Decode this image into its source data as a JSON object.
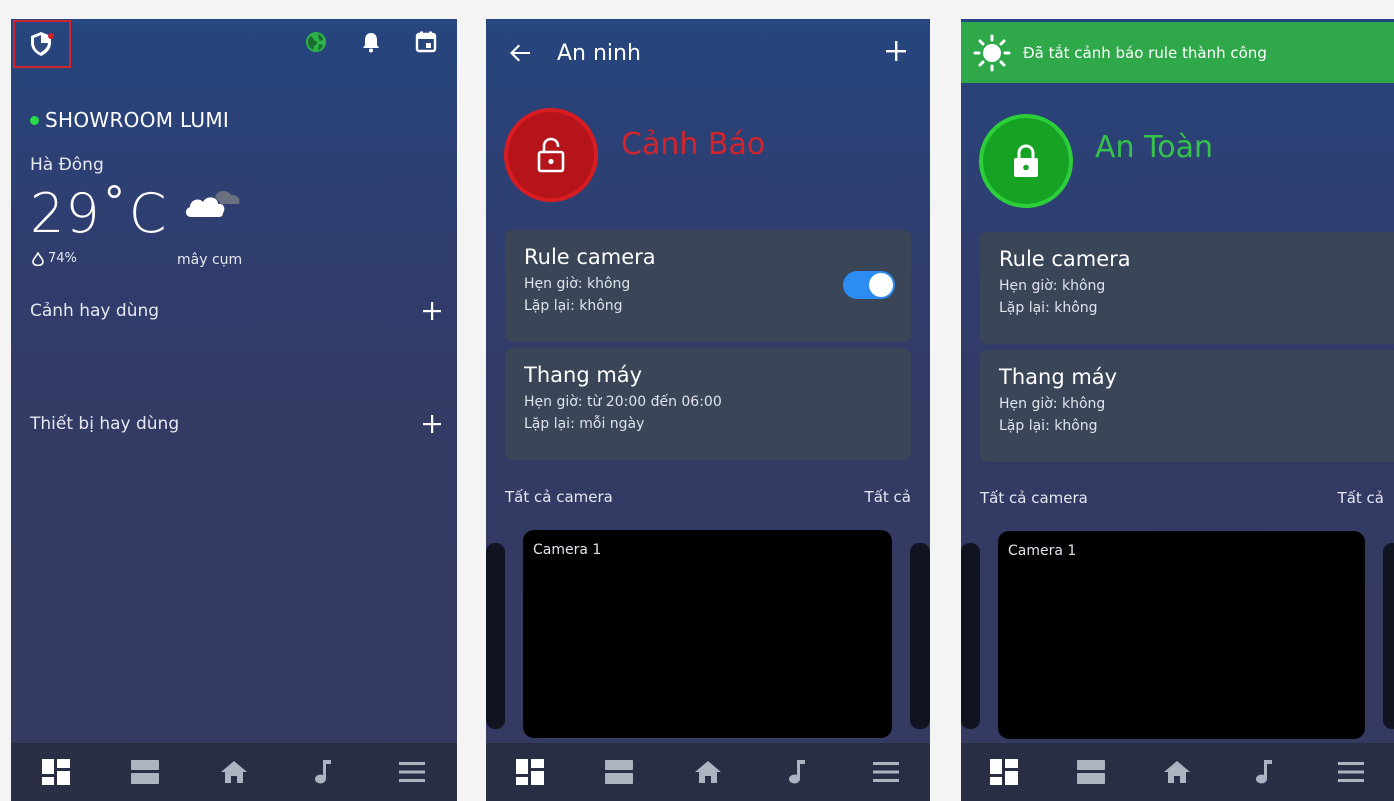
{
  "colors": {
    "alert_red": "#d2242a",
    "safe_green": "#34c24a",
    "toggle_blue": "#2d8cf0",
    "toast_green": "#2fa84a"
  },
  "home": {
    "top_icons": [
      "shield-icon",
      "globe-icon",
      "bell-icon",
      "calendar-icon"
    ],
    "name": "SHOWROOM LUMI",
    "city": "Hà Đông",
    "temperature": "29˚C",
    "humidity": "74%",
    "weather": "mây cụm",
    "favorite_scenes": "Cảnh hay dùng",
    "favorite_devices": "Thiết bị hay dùng"
  },
  "security_alert": {
    "title": "An ninh",
    "status": "Cảnh Báo",
    "rules": [
      {
        "name": "Rule camera",
        "schedule": "Hẹn giờ: không",
        "repeat": "Lặp lại: không",
        "enabled": true
      },
      {
        "name": "Thang máy",
        "schedule": "Hẹn giờ: từ 20:00 đến 06:00",
        "repeat": "Lặp lại: mỗi ngày"
      }
    ],
    "cameras_label": "Tất cả camera",
    "see_all": "Tất cả",
    "camera_name": "Camera 1"
  },
  "security_safe": {
    "toast": "Đã tắt cảnh báo rule thành công",
    "status": "An Toàn",
    "rules": [
      {
        "name": "Rule camera",
        "schedule": "Hẹn giờ: không",
        "repeat": "Lặp lại: không"
      },
      {
        "name": "Thang máy",
        "schedule": "Hẹn giờ: không",
        "repeat": "Lặp lại: không"
      }
    ],
    "cameras_label": "Tất cả camera",
    "see_all": "Tất cả",
    "camera_name": "Camera 1"
  },
  "bottom_nav": [
    "dashboard-icon",
    "rooms-icon",
    "home-icon",
    "music-icon",
    "menu-icon"
  ]
}
